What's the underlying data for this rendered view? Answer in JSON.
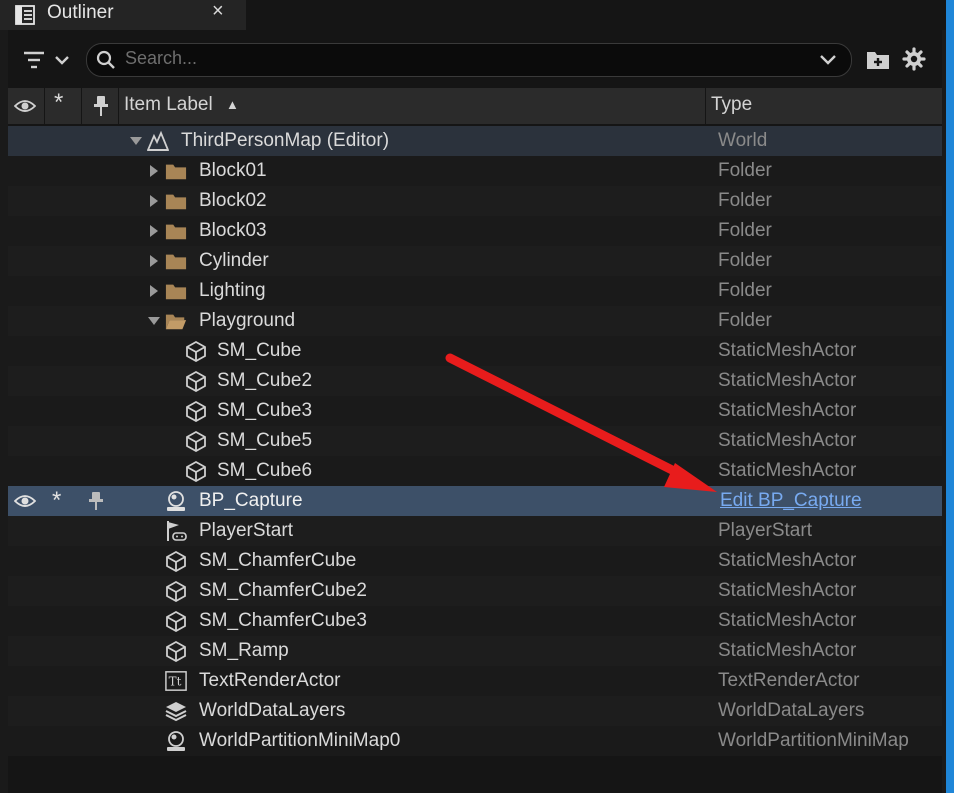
{
  "tab": {
    "title": "Outliner",
    "close": "×"
  },
  "search": {
    "placeholder": "Search..."
  },
  "columns": {
    "item_label": "Item Label",
    "type": "Type",
    "sort_indicator": "▲"
  },
  "rows": [
    {
      "label": "ThirdPersonMap (Editor)",
      "type": "World"
    },
    {
      "label": "Block01",
      "type": "Folder"
    },
    {
      "label": "Block02",
      "type": "Folder"
    },
    {
      "label": "Block03",
      "type": "Folder"
    },
    {
      "label": "Cylinder",
      "type": "Folder"
    },
    {
      "label": "Lighting",
      "type": "Folder"
    },
    {
      "label": "Playground",
      "type": "Folder"
    },
    {
      "label": "SM_Cube",
      "type": "StaticMeshActor"
    },
    {
      "label": "SM_Cube2",
      "type": "StaticMeshActor"
    },
    {
      "label": "SM_Cube3",
      "type": "StaticMeshActor"
    },
    {
      "label": "SM_Cube5",
      "type": "StaticMeshActor"
    },
    {
      "label": "SM_Cube6",
      "type": "StaticMeshActor"
    },
    {
      "label": "BP_Capture",
      "type": "Edit BP_Capture"
    },
    {
      "label": "PlayerStart",
      "type": "PlayerStart"
    },
    {
      "label": "SM_ChamferCube",
      "type": "StaticMeshActor"
    },
    {
      "label": "SM_ChamferCube2",
      "type": "StaticMeshActor"
    },
    {
      "label": "SM_ChamferCube3",
      "type": "StaticMeshActor"
    },
    {
      "label": "SM_Ramp",
      "type": "StaticMeshActor"
    },
    {
      "label": "TextRenderActor",
      "type": "TextRenderActor"
    },
    {
      "label": "WorldDataLayers",
      "type": "WorldDataLayers"
    },
    {
      "label": "WorldPartitionMiniMap0",
      "type": "WorldPartitionMiniMap"
    }
  ],
  "selected_row": {
    "star": "*"
  },
  "colors": {
    "selected_row": "#3d5068",
    "link": "#78aaf0",
    "annotation_arrow": "#e81c1c",
    "accent_strip": "#1f86d8"
  }
}
